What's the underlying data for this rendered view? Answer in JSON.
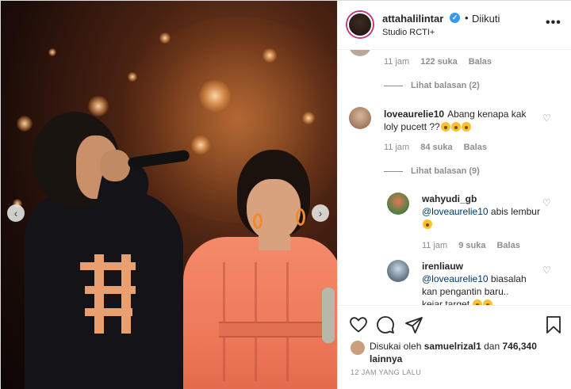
{
  "post": {
    "username": "attahalilintar",
    "follow_status": "Diikuti",
    "location": "Studio RCTI+",
    "time_ago": "12 JAM YANG LALU"
  },
  "photo": {
    "prev_icon": "chevron-left-icon",
    "next_icon": "chevron-right-icon"
  },
  "comments": [
    {
      "time": "11 jam",
      "likes": "122 suka",
      "reply": "Balas",
      "view_replies": "Lihat balasan (2)"
    },
    {
      "username": "loveaurelie10",
      "text": "Abang kenapa kak loly pucett ??",
      "time": "11 jam",
      "likes": "84 suka",
      "reply": "Balas",
      "view_replies": "Lihat balasan (9)"
    }
  ],
  "replies": [
    {
      "username": "wahyudi_gb",
      "mention": "@loveaurelie10",
      "text": "abis lembur",
      "time": "11 jam",
      "likes": "9 suka",
      "reply": "Balas"
    },
    {
      "username": "irenliauw",
      "mention": "@loveaurelie10",
      "text": "biasalah kan pengantin baru..",
      "text2": "kejar target"
    }
  ],
  "likes": {
    "prefix": "Disukai oleh",
    "user": "samuelrizal1",
    "connector": "dan",
    "count": "746,340 lainnya"
  },
  "colors": {
    "mention": "#00376b",
    "verified": "#3897f0",
    "muted": "#8e8e8e"
  }
}
